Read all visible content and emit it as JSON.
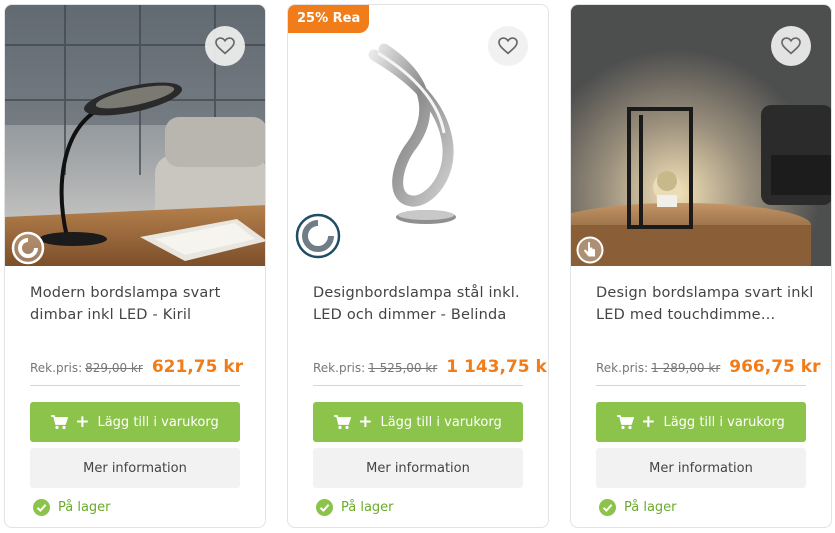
{
  "colors": {
    "accent_orange": "#f07d1a",
    "cart_green": "#8cc34b",
    "stock_green": "#6aab2a"
  },
  "products": [
    {
      "title": "Modern bordslampa svart dimbar inkl LED - Kiril",
      "rek_label": "Rek.pris:",
      "old_price": "829,00 kr",
      "price": "621,75 kr",
      "cart_label": "Lägg till i varukorg",
      "info_label": "Mer information",
      "stock": "På lager",
      "feature_icon": "dimmer-icon"
    },
    {
      "badge": "25% Rea",
      "title": "Designbordslampa stål inkl. LED och dimmer - Belinda",
      "rek_label": "Rek.pris:",
      "old_price": "1 525,00 kr",
      "price": "1 143,75 kr",
      "cart_label": "Lägg till i varukorg",
      "info_label": "Mer information",
      "stock": "På lager",
      "feature_icon": "dimmer-icon"
    },
    {
      "title": "Design bordslampa svart inkl LED med touchdimme…",
      "rek_label": "Rek.pris:",
      "old_price": "1 289,00 kr",
      "price": "966,75 kr",
      "cart_label": "Lägg till i varukorg",
      "info_label": "Mer information",
      "stock": "På lager",
      "feature_icon": "touch-icon"
    }
  ]
}
